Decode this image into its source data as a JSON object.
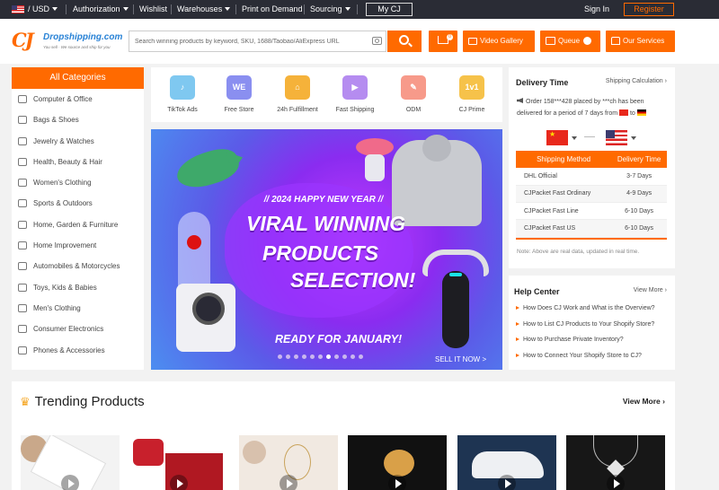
{
  "topbar": {
    "currency": "USD",
    "authorization": "Authorization",
    "wishlist": "Wishlist",
    "warehouses": "Warehouses",
    "print_on_demand": "Print on Demand",
    "sourcing": "Sourcing",
    "my_cj": "My CJ",
    "sign_in": "Sign In",
    "register": "Register"
  },
  "header": {
    "logo_mark": "CJ",
    "logo_text": "Dropshipping.com",
    "logo_tagline": "You sell · We source and ship for you",
    "search_placeholder": "Search winning products by keyword, SKU, 1688/Taobao/AliExpress URL",
    "cart_count": "0",
    "video_gallery": "Video Gallery",
    "queue": "Queue",
    "our_services": "Our Services"
  },
  "categories": {
    "title": "All Categories",
    "items": [
      "Computer & Office",
      "Bags & Shoes",
      "Jewelry & Watches",
      "Health, Beauty & Hair",
      "Women's Clothing",
      "Sports & Outdoors",
      "Home, Garden & Furniture",
      "Home Improvement",
      "Automobiles & Motorcycles",
      "Toys, Kids & Babies",
      "Men's Clothing",
      "Consumer Electronics",
      "Phones & Accessories"
    ]
  },
  "services": [
    {
      "label": "TikTok Ads",
      "glyph": "♪",
      "color": "#7fc8f0"
    },
    {
      "label": "Free Store",
      "glyph": "WE",
      "color": "#8a8ff0"
    },
    {
      "label": "24h Fulfillment",
      "glyph": "⌂",
      "color": "#f5b23a"
    },
    {
      "label": "Fast Shipping",
      "glyph": "▶",
      "color": "#b58cf0"
    },
    {
      "label": "ODM",
      "glyph": "✎",
      "color": "#f79a8a"
    },
    {
      "label": "CJ Prime",
      "glyph": "1v1",
      "color": "#f6c24a"
    }
  ],
  "banner": {
    "new_year": "// 2024 HAPPY NEW YEAR //",
    "line1": "VIRAL WINNING",
    "line2": "PRODUCTS",
    "line3": "SELECTION!",
    "ready": "READY FOR JANUARY!",
    "cta": "SELL IT NOW >",
    "active_dot": 6
  },
  "delivery": {
    "title": "Delivery Time",
    "calc_link": "Shipping Calculation",
    "order_text": "Order 158***428 placed by ***ch has been delivered for a period of 7 days from",
    "order_to": "to",
    "headers": [
      "Shipping Method",
      "Delivery Time"
    ],
    "rows": [
      [
        "DHL Official",
        "3-7 Days"
      ],
      [
        "CJPacket Fast Ordinary",
        "4-9 Days"
      ],
      [
        "CJPacket Fast Line",
        "6-10 Days"
      ],
      [
        "CJPacket Fast US",
        "6-10 Days"
      ]
    ],
    "note": "Note: Above are real data, updated in real time."
  },
  "help": {
    "title": "Help Center",
    "more": "View More",
    "items": [
      "How Does CJ Work and What is the Overview?",
      "How to List CJ Products to Your Shopify Store?",
      "How to Purchase Private Inventory?",
      "How to Connect Your Shopify Store to CJ?"
    ]
  },
  "trending": {
    "title": "Trending Products",
    "more": "View More"
  },
  "colors": {
    "accent": "#ff6a00",
    "topbar": "#2a2c35",
    "link_blue": "#2a83d6"
  }
}
